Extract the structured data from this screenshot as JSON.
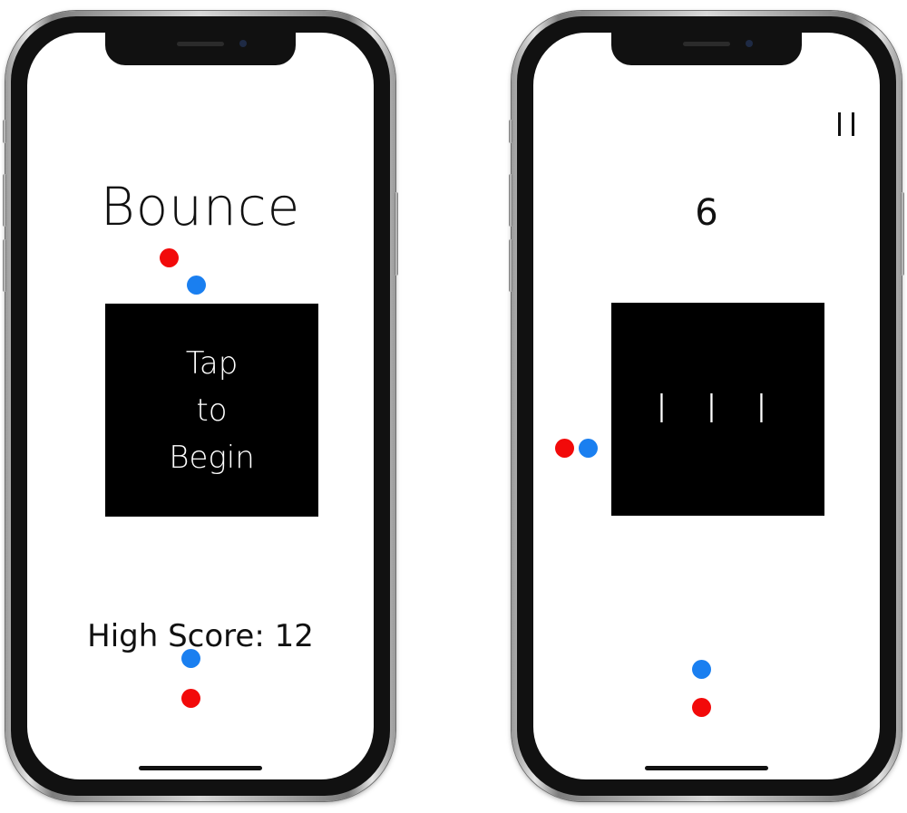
{
  "colors": {
    "red_dot": "#f20a0a",
    "blue_dot": "#1a7ff0",
    "block": "#000000",
    "background": "#ffffff"
  },
  "start_screen": {
    "title": "Bounce",
    "start_button_lines": [
      "Tap",
      "to",
      "Begin"
    ],
    "high_score_label": "High Score: 12"
  },
  "game_screen": {
    "score": "6",
    "pause_icon": "pause-icon",
    "block_label": "I I I"
  }
}
